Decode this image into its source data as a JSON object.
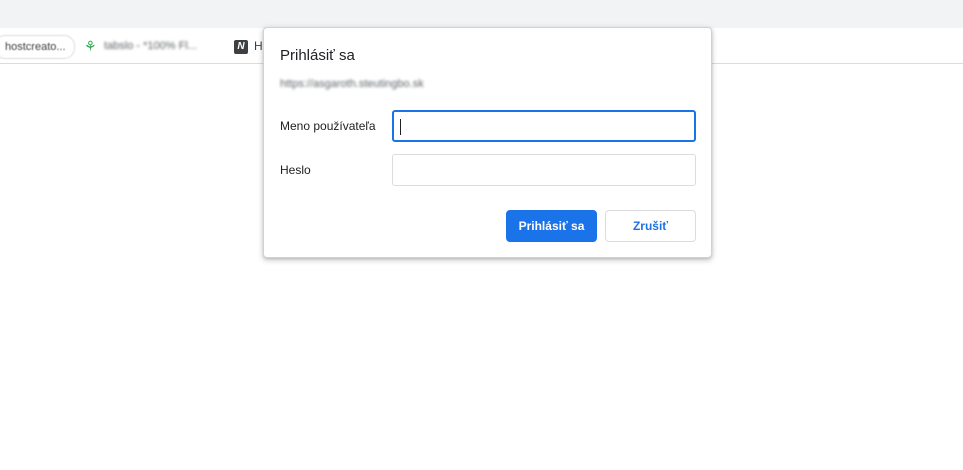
{
  "browser": {
    "bookmarks": [
      {
        "label": "hostcreato...",
        "icon": "pill-bookmark"
      },
      {
        "label": "tabslo - *100% Fl...",
        "icon": "leaf-icon"
      },
      {
        "label": "H",
        "icon": "h-logo-icon"
      }
    ]
  },
  "dialog": {
    "title": "Prihlásiť sa",
    "origin": "https://asgaroth.steutingbo.sk",
    "username_label": "Meno používateľa",
    "username_value": "",
    "password_label": "Heslo",
    "password_value": "",
    "submit_label": "Prihlásiť sa",
    "cancel_label": "Zrušiť"
  },
  "colors": {
    "accent": "#1a73e8",
    "toolbar": "#f1f3f4",
    "border": "#dadce0"
  }
}
